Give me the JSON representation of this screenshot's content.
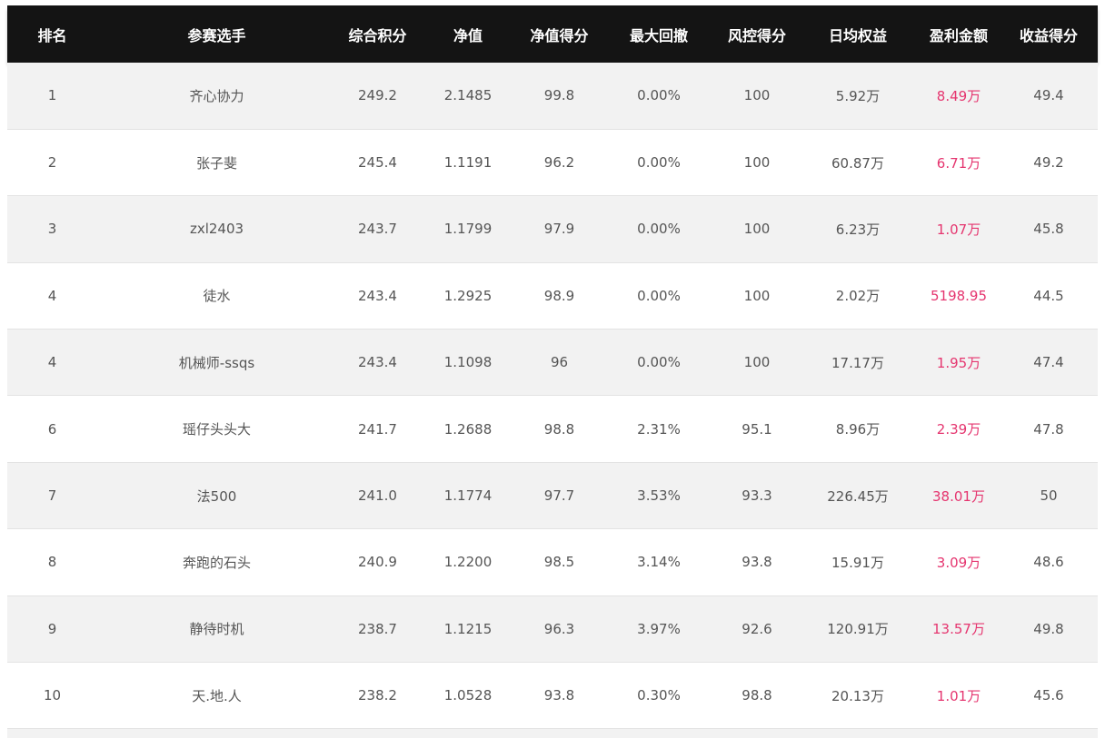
{
  "headers": {
    "rank": "排名",
    "player": "参赛选手",
    "total_score": "综合积分",
    "nav": "净值",
    "nav_score": "净值得分",
    "max_drawdown": "最大回撤",
    "risk_score": "风控得分",
    "daily_equity": "日均权益",
    "profit": "盈利金额",
    "return_score": "收益得分"
  },
  "colors": {
    "header_bg": "#141414",
    "row_alt_bg": "#f2f2f2",
    "profit_text": "#e5356f",
    "body_text": "#555555"
  },
  "rows": [
    {
      "rank": "1",
      "player": "齐心协力",
      "total_score": "249.2",
      "nav": "2.1485",
      "nav_score": "99.8",
      "max_drawdown": "0.00%",
      "risk_score": "100",
      "daily_equity": "5.92万",
      "profit": "8.49万",
      "return_score": "49.4"
    },
    {
      "rank": "2",
      "player": "张子斐",
      "total_score": "245.4",
      "nav": "1.1191",
      "nav_score": "96.2",
      "max_drawdown": "0.00%",
      "risk_score": "100",
      "daily_equity": "60.87万",
      "profit": "6.71万",
      "return_score": "49.2"
    },
    {
      "rank": "3",
      "player": "zxl2403",
      "total_score": "243.7",
      "nav": "1.1799",
      "nav_score": "97.9",
      "max_drawdown": "0.00%",
      "risk_score": "100",
      "daily_equity": "6.23万",
      "profit": "1.07万",
      "return_score": "45.8"
    },
    {
      "rank": "4",
      "player": "徒水",
      "total_score": "243.4",
      "nav": "1.2925",
      "nav_score": "98.9",
      "max_drawdown": "0.00%",
      "risk_score": "100",
      "daily_equity": "2.02万",
      "profit": "5198.95",
      "return_score": "44.5"
    },
    {
      "rank": "4",
      "player": "机械师-ssqs",
      "total_score": "243.4",
      "nav": "1.1098",
      "nav_score": "96",
      "max_drawdown": "0.00%",
      "risk_score": "100",
      "daily_equity": "17.17万",
      "profit": "1.95万",
      "return_score": "47.4"
    },
    {
      "rank": "6",
      "player": "瑶仔头头大",
      "total_score": "241.7",
      "nav": "1.2688",
      "nav_score": "98.8",
      "max_drawdown": "2.31%",
      "risk_score": "95.1",
      "daily_equity": "8.96万",
      "profit": "2.39万",
      "return_score": "47.8"
    },
    {
      "rank": "7",
      "player": "法500",
      "total_score": "241.0",
      "nav": "1.1774",
      "nav_score": "97.7",
      "max_drawdown": "3.53%",
      "risk_score": "93.3",
      "daily_equity": "226.45万",
      "profit": "38.01万",
      "return_score": "50"
    },
    {
      "rank": "8",
      "player": "奔跑的石头",
      "total_score": "240.9",
      "nav": "1.2200",
      "nav_score": "98.5",
      "max_drawdown": "3.14%",
      "risk_score": "93.8",
      "daily_equity": "15.91万",
      "profit": "3.09万",
      "return_score": "48.6"
    },
    {
      "rank": "9",
      "player": "静待时机",
      "total_score": "238.7",
      "nav": "1.1215",
      "nav_score": "96.3",
      "max_drawdown": "3.97%",
      "risk_score": "92.6",
      "daily_equity": "120.91万",
      "profit": "13.57万",
      "return_score": "49.8"
    },
    {
      "rank": "10",
      "player": "天.地.人",
      "total_score": "238.2",
      "nav": "1.0528",
      "nav_score": "93.8",
      "max_drawdown": "0.30%",
      "risk_score": "98.8",
      "daily_equity": "20.13万",
      "profit": "1.01万",
      "return_score": "45.6"
    }
  ]
}
